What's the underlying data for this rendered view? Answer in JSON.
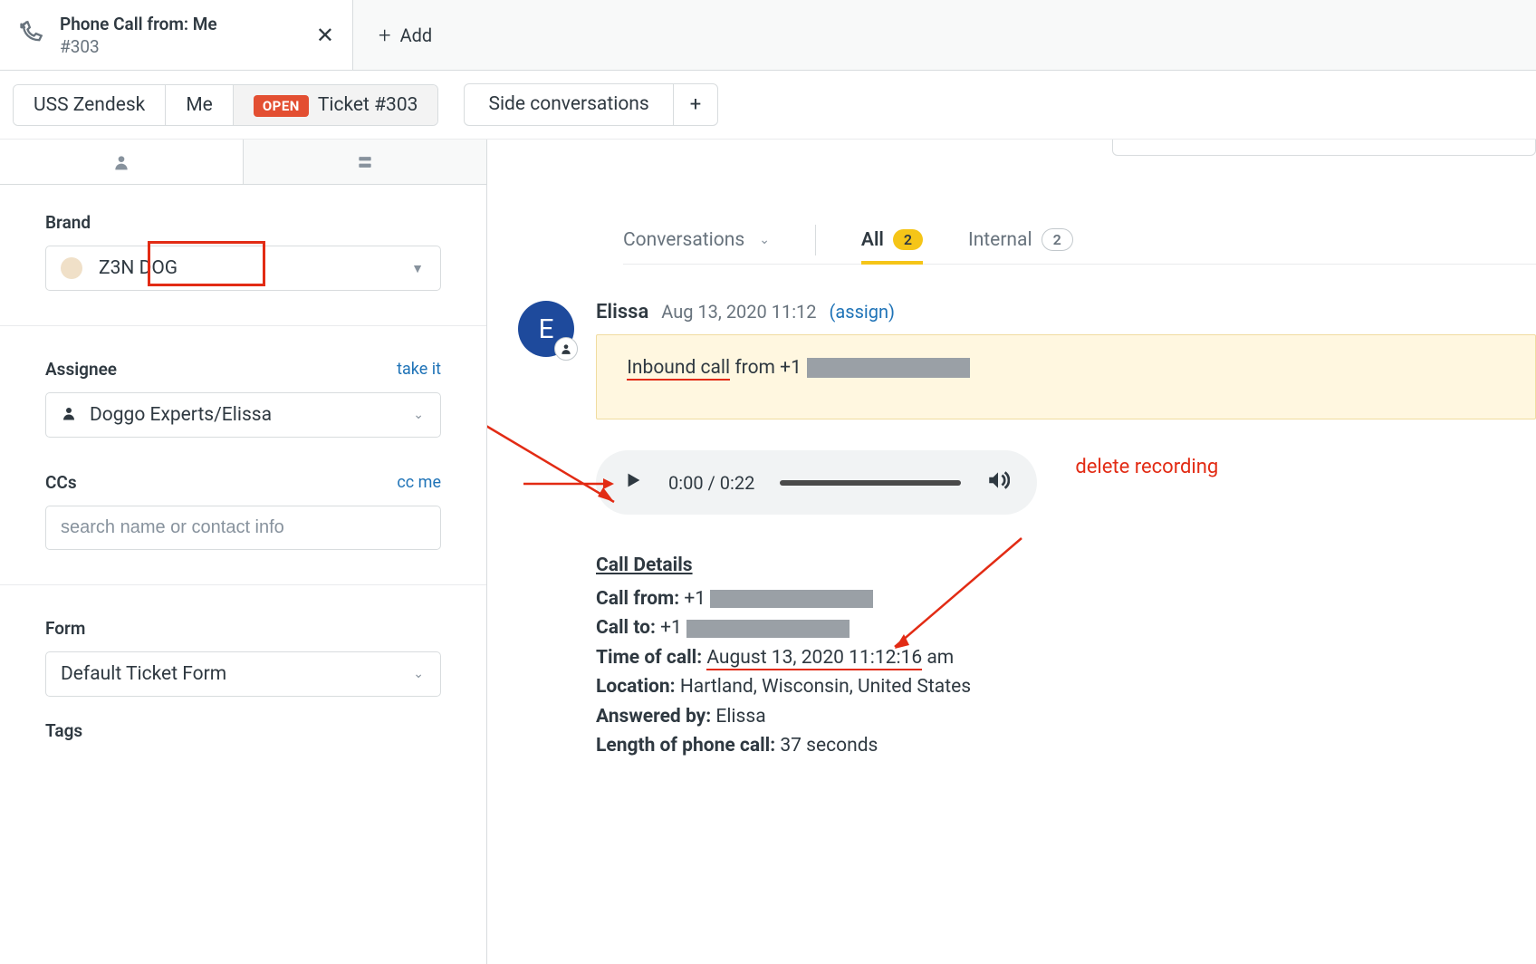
{
  "top": {
    "title": "Phone Call from: Me",
    "ticket_id": "#303",
    "add": "Add"
  },
  "breadcrumbs": {
    "org": "USS Zendesk",
    "user": "Me",
    "status": "OPEN",
    "ticket": "Ticket #303"
  },
  "side_conversations": {
    "label": "Side conversations"
  },
  "sidebar": {
    "brand_label": "Brand",
    "brand_value": "Z3N DOG",
    "assignee_label": "Assignee",
    "take_it": "take it",
    "assignee_value": "Doggo Experts/Elissa",
    "ccs_label": "CCs",
    "cc_me": "cc me",
    "ccs_placeholder": "search name or contact info",
    "form_label": "Form",
    "form_value": "Default Ticket Form",
    "tags_label": "Tags"
  },
  "tabs": {
    "conversations": "Conversations",
    "all": "All",
    "all_count": "2",
    "internal": "Internal",
    "internal_count": "2"
  },
  "conversation": {
    "avatar_initial": "E",
    "name": "Elissa",
    "timestamp": "Aug 13, 2020 11:12",
    "assign": "(assign)",
    "inbound_prefix": "Inbound call",
    "inbound_suffix": " from +1 ",
    "audio_time": "0:00 / 0:22",
    "delete": "delete recording"
  },
  "details": {
    "header": "Call Details",
    "call_from_label": "Call from:",
    "call_from_prefix": " +1 ",
    "call_to_label": "Call to:",
    "call_to_prefix": " +1 ",
    "time_label": "Time of call:",
    "time_value_underlined": "August 13, 2020 11:12:16",
    "time_value_suffix": " am",
    "location_label": "Location:",
    "location_value": " Hartland, Wisconsin, United States",
    "answered_label": "Answered by:",
    "answered_value": " Elissa",
    "length_label": "Length of phone call:",
    "length_value": " 37 seconds"
  }
}
